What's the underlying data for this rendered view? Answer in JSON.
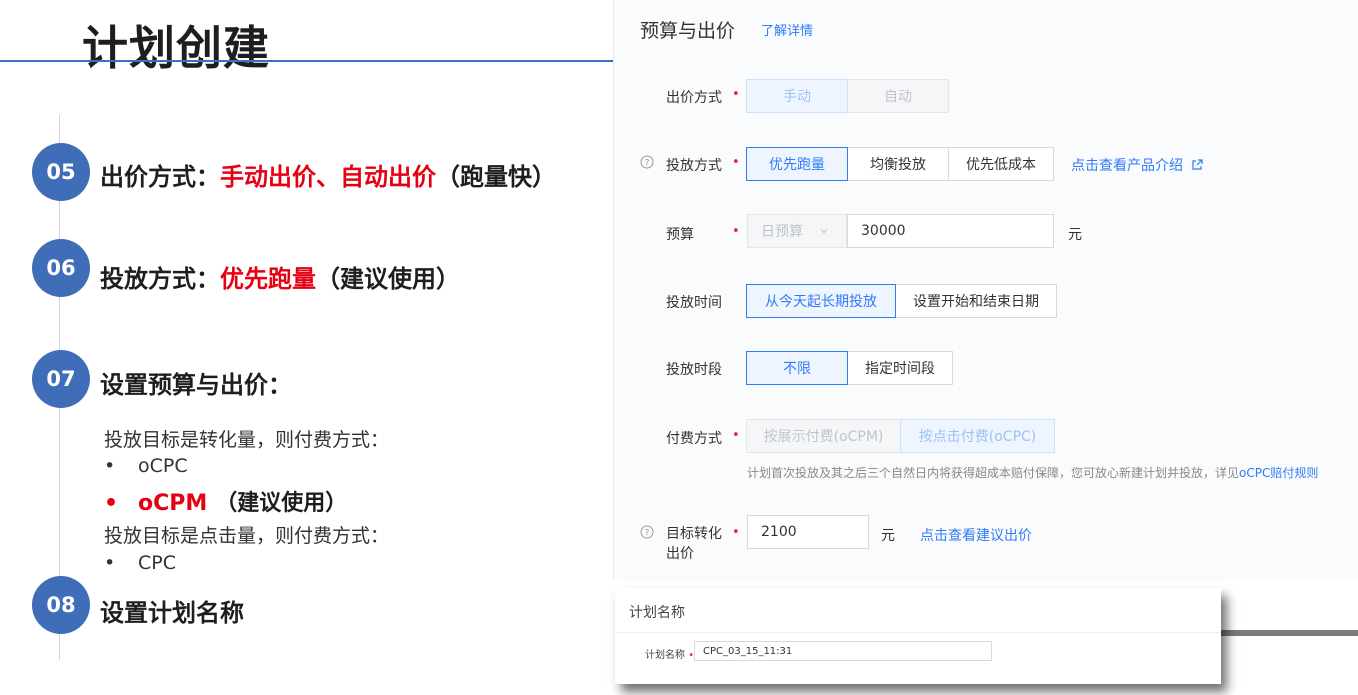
{
  "slide": {
    "title": "计划创建",
    "steps": [
      {
        "num": "05",
        "label": "出价方式：",
        "highlight": "手动出价、自动出价",
        "note": "（跑量快）"
      },
      {
        "num": "06",
        "label": "投放方式：",
        "highlight": "优先跑量",
        "note": "（建议使用）"
      },
      {
        "num": "07",
        "label": "设置预算与出价："
      },
      {
        "num": "08",
        "label": "设置计划名称"
      }
    ],
    "sub": {
      "conv_text": "投放目标是转化量，则付费方式：",
      "conv_items": [
        "oCPC"
      ],
      "conv_highlight": {
        "name": "oCPM",
        "note": "（建议使用）"
      },
      "click_text": "投放目标是点击量，则付费方式：",
      "click_items": [
        "CPC"
      ],
      "bullet": "•"
    }
  },
  "form": {
    "title": "预算与出价",
    "detail_link": "了解详情",
    "required_mark": "•",
    "bid_method": {
      "label": "出价方式",
      "options": [
        "手动",
        "自动"
      ]
    },
    "delivery_method": {
      "label": "投放方式",
      "options": [
        "优先跑量",
        "均衡投放",
        "优先低成本"
      ],
      "link": "点击查看产品介绍"
    },
    "budget": {
      "label": "预算",
      "select": "日预算",
      "value": "30000",
      "unit": "元"
    },
    "delivery_time": {
      "label": "投放时间",
      "options": [
        "从今天起长期投放",
        "设置开始和结束日期"
      ]
    },
    "delivery_period": {
      "label": "投放时段",
      "options": [
        "不限",
        "指定时间段"
      ]
    },
    "payment": {
      "label": "付费方式",
      "options": [
        "按展示付费(oCPM)",
        "按点击付费(oCPC)"
      ],
      "hint": "计划首次投放及其之后三个自然日内将获得超成本赔付保障，您可放心新建计划并投放，详见",
      "hint_link": "oCPC赔付规则"
    },
    "target_bid": {
      "label_line1": "目标转化",
      "label_line2": "出价",
      "value": "2100",
      "unit": "元",
      "link": "点击查看建议出价"
    }
  },
  "name_card": {
    "title": "计划名称",
    "label": "计划名称",
    "value": "CPC_03_15_11:31"
  },
  "colors": {
    "accent": "#2f7cf6",
    "step_circle": "#3f6db8",
    "highlight_red": "#e60012"
  }
}
